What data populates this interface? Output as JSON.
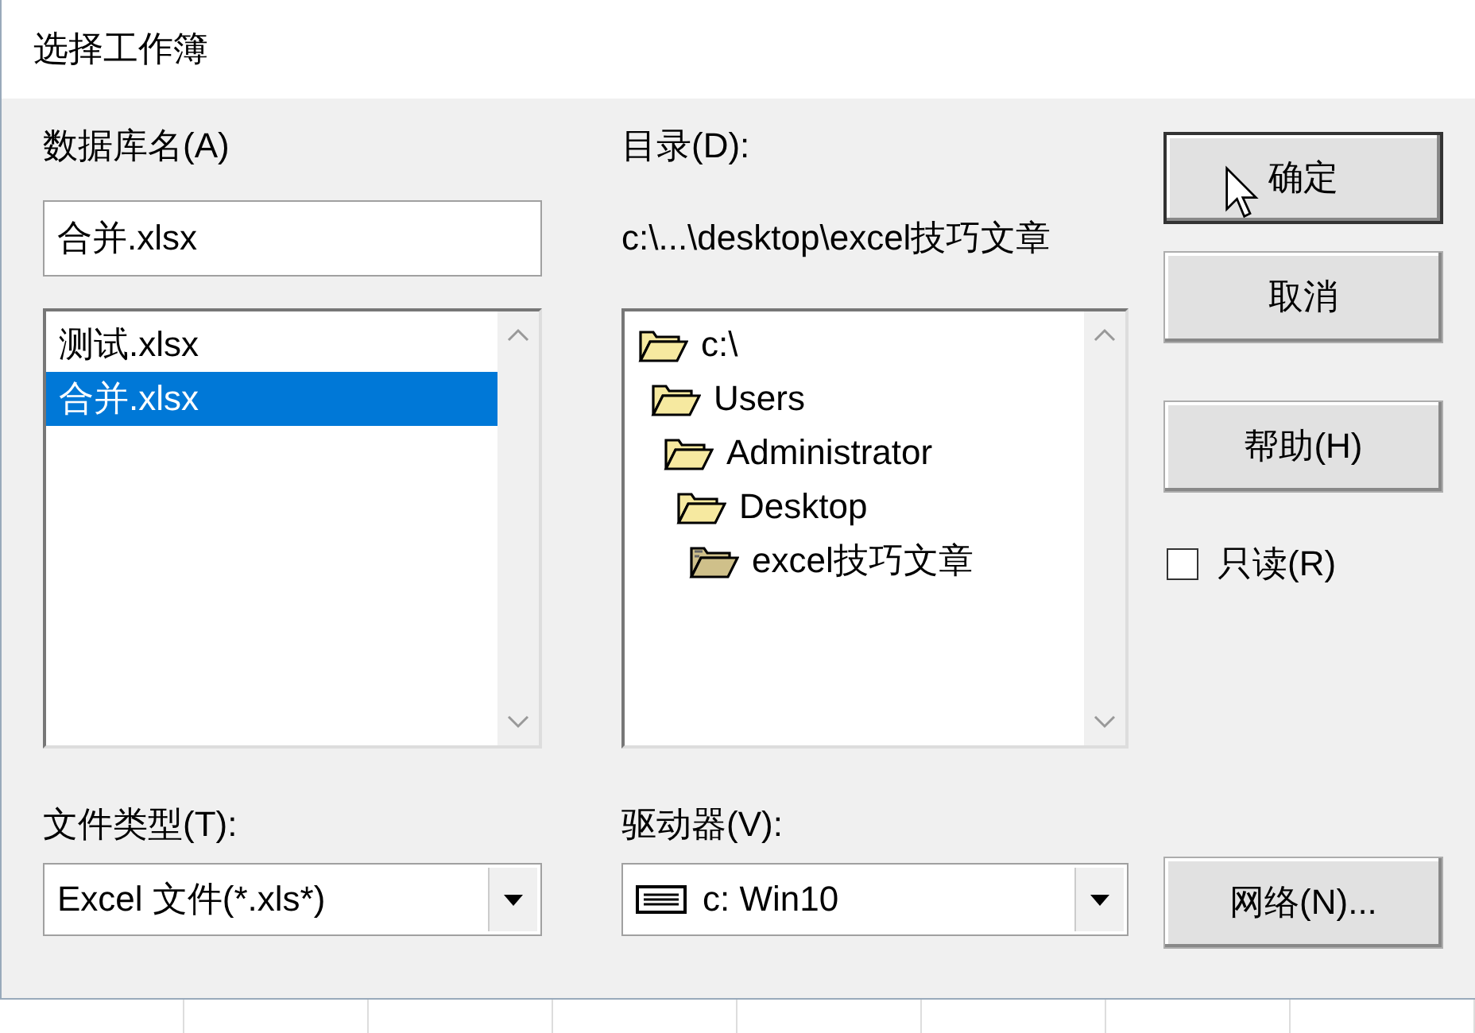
{
  "window": {
    "title": "选择工作簿"
  },
  "database": {
    "label": "数据库名(A)",
    "value": "合并.xlsx",
    "files": [
      {
        "name": "测试.xlsx",
        "selected": false
      },
      {
        "name": "合并.xlsx",
        "selected": true
      }
    ]
  },
  "directory": {
    "label": "目录(D):",
    "path": "c:\\...\\desktop\\excel技巧文章",
    "tree": [
      {
        "name": "c:\\",
        "current": false,
        "children": [
          {
            "name": "Users",
            "current": false,
            "children": [
              {
                "name": "Administrator",
                "current": false,
                "children": [
                  {
                    "name": "Desktop",
                    "current": false,
                    "children": [
                      {
                        "name": "excel技巧文章",
                        "current": true
                      }
                    ]
                  }
                ]
              }
            ]
          }
        ]
      }
    ]
  },
  "file_type": {
    "label": "文件类型(T):",
    "value": "Excel 文件(*.xls*)"
  },
  "drive": {
    "label": "驱动器(V):",
    "value": "c: Win10"
  },
  "buttons": [
    {
      "label": "确定",
      "default": true
    },
    {
      "label": "取消",
      "default": false
    },
    {
      "label": "帮助(H)",
      "default": false
    }
  ],
  "read_only": {
    "label": "只读(R)",
    "checked": false
  },
  "network_button": {
    "label": "网络(N)..."
  }
}
